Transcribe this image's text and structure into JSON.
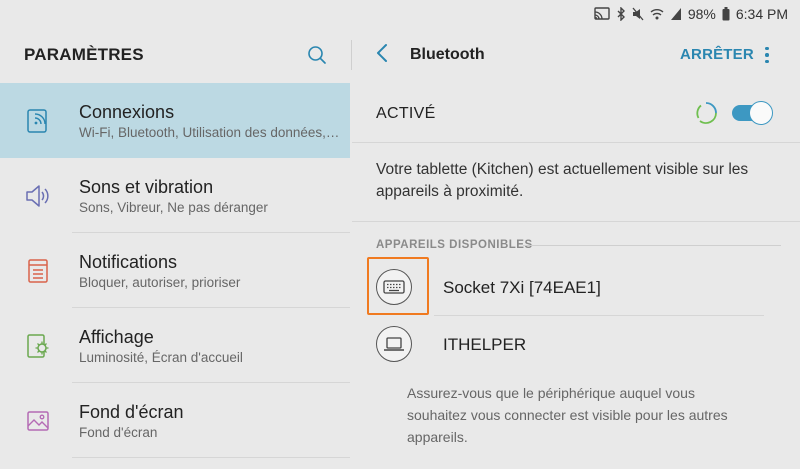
{
  "status_bar": {
    "battery": "98%",
    "time": "6:34 PM"
  },
  "left_panel": {
    "title": "PARAMÈTRES",
    "items": [
      {
        "title": "Connexions",
        "subtitle": "Wi-Fi, Bluetooth, Utilisation des données, Mode Hors-ligne",
        "icon": "connections-icon",
        "active": true
      },
      {
        "title": "Sons et vibration",
        "subtitle": "Sons, Vibreur, Ne pas déranger",
        "icon": "speaker-icon",
        "active": false
      },
      {
        "title": "Notifications",
        "subtitle": "Bloquer, autoriser, prioriser",
        "icon": "notifications-icon",
        "active": false
      },
      {
        "title": "Affichage",
        "subtitle": "Luminosité, Écran d'accueil",
        "icon": "display-icon",
        "active": false
      },
      {
        "title": "Fond d'écran",
        "subtitle": "Fond d'écran",
        "icon": "wallpaper-icon",
        "active": false
      }
    ]
  },
  "right_panel": {
    "title": "Bluetooth",
    "stop_label": "ARRÊTER",
    "active_label": "ACTIVÉ",
    "toggle_on": true,
    "visible_text": "Votre tablette (Kitchen) est actuellement visible sur les appareils à proximité.",
    "available_label": "APPAREILS DISPONIBLES",
    "devices": [
      {
        "name": "Socket 7Xi [74EAE1]",
        "icon": "keyboard-icon"
      },
      {
        "name": "ITHELPER",
        "icon": "laptop-icon"
      }
    ],
    "hint": "Assurez-vous que le périphérique auquel vous souhaitez vous connecter est visible pour les autres appareils."
  },
  "colors": {
    "accent": "#2a86b0",
    "active_bg": "#bcd9e3",
    "highlight": "#f07a20",
    "toggle": "#3d98c2"
  }
}
